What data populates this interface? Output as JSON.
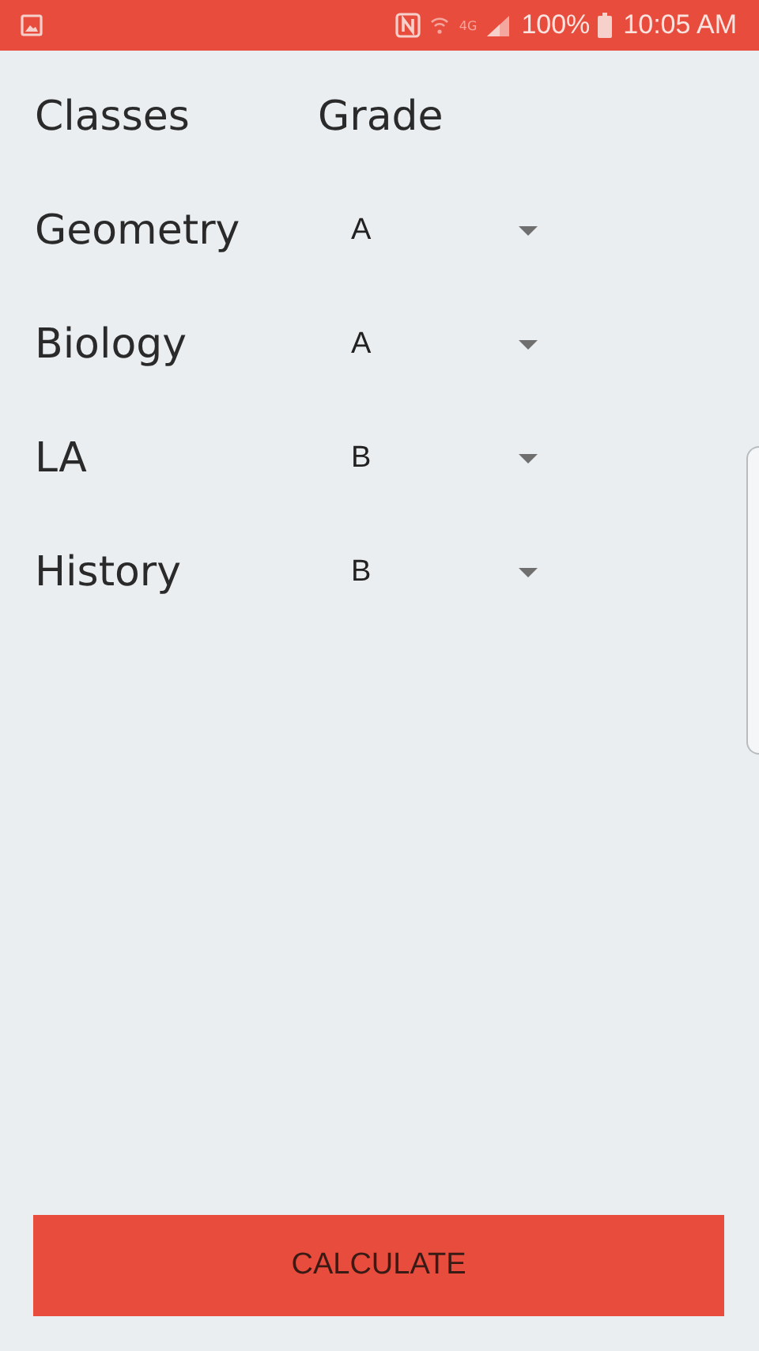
{
  "status_bar": {
    "network": "4G",
    "battery": "100%",
    "time": "10:05 AM"
  },
  "header": {
    "classes": "Classes",
    "grade": "Grade"
  },
  "rows": [
    {
      "class": "Geometry",
      "grade": "A"
    },
    {
      "class": "Biology",
      "grade": "A"
    },
    {
      "class": "LA",
      "grade": "B"
    },
    {
      "class": "History",
      "grade": "B"
    }
  ],
  "button": "CALCULATE"
}
